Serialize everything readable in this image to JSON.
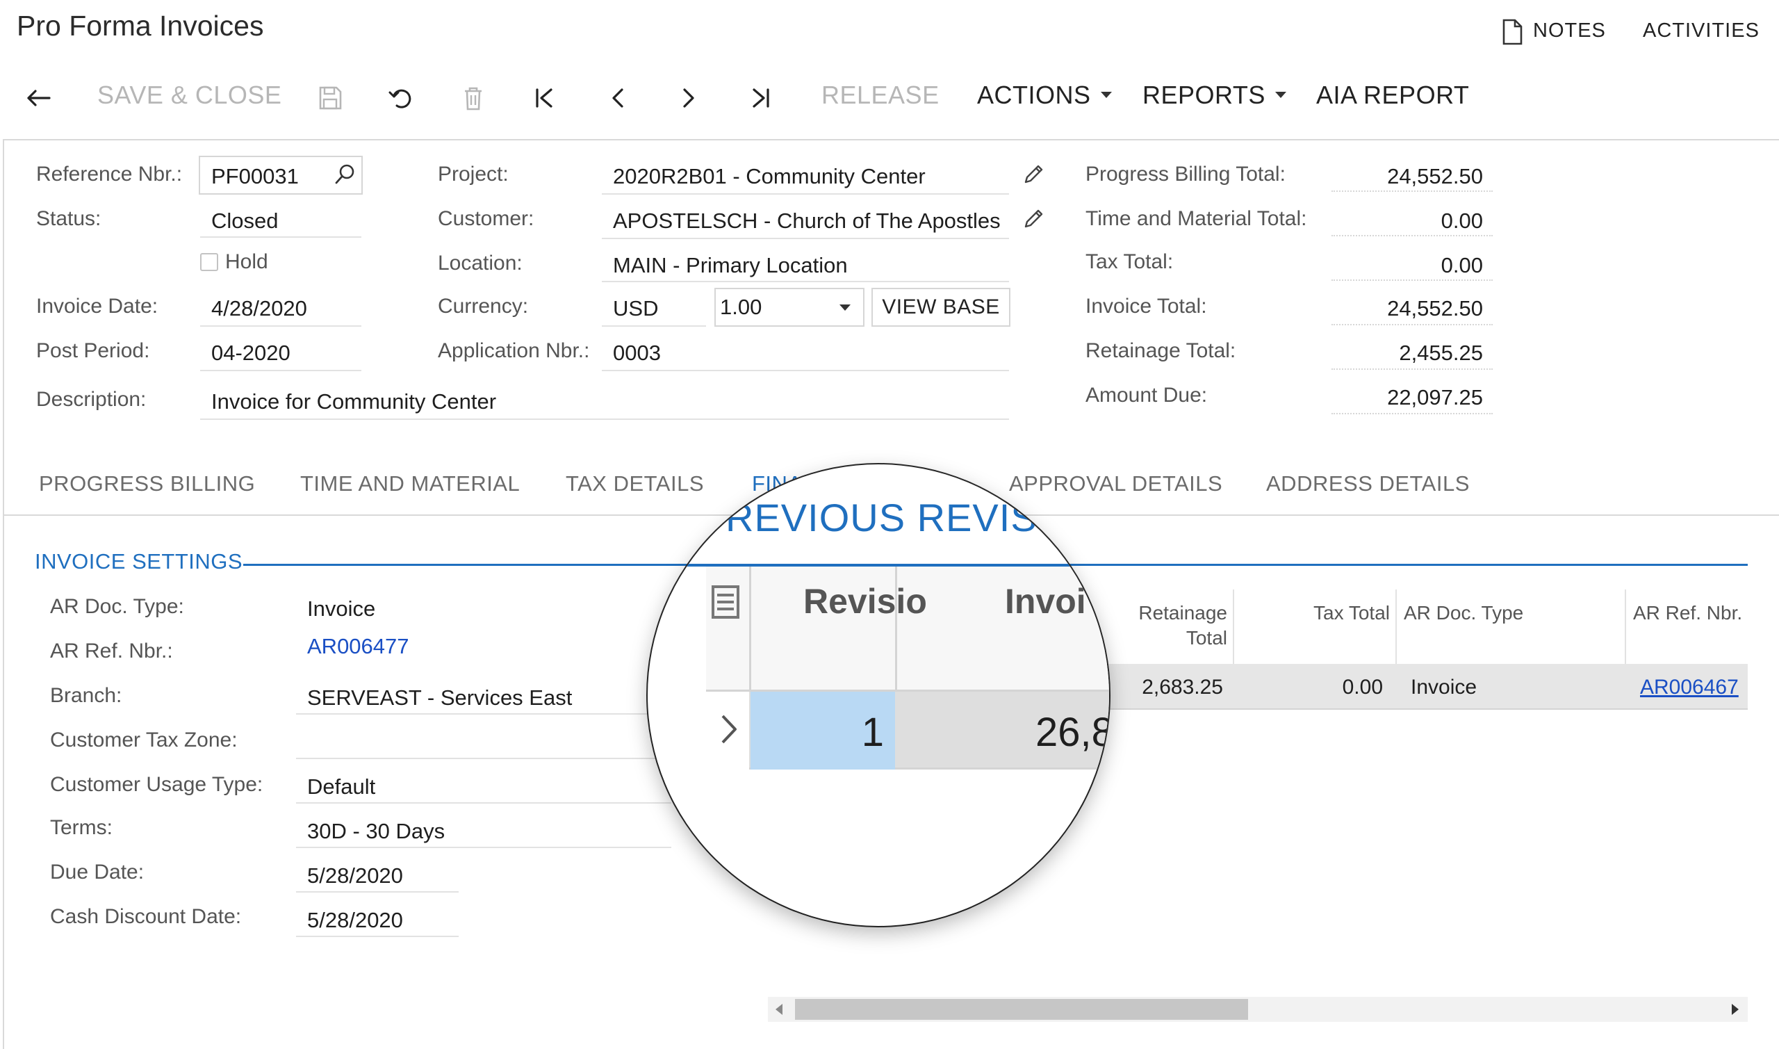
{
  "header": {
    "title": "Pro Forma Invoices",
    "notes_label": "NOTES",
    "activities_label": "ACTIVITIES"
  },
  "toolbar": {
    "save_close": "SAVE & CLOSE",
    "release": "RELEASE",
    "actions": "ACTIONS",
    "reports": "REPORTS",
    "aia_report": "AIA REPORT"
  },
  "form": {
    "reference_nbr_label": "Reference Nbr.:",
    "reference_nbr": "PF00031",
    "status_label": "Status:",
    "status": "Closed",
    "hold_label": "Hold",
    "invoice_date_label": "Invoice Date:",
    "invoice_date": "4/28/2020",
    "post_period_label": "Post Period:",
    "post_period": "04-2020",
    "description_label": "Description:",
    "description": "Invoice for Community Center",
    "project_label": "Project:",
    "project": "2020R2B01 - Community Center",
    "customer_label": "Customer:",
    "customer": "APOSTELSCH - Church of The Apostles",
    "location_label": "Location:",
    "location": "MAIN - Primary Location",
    "currency_label": "Currency:",
    "currency": "USD",
    "currency_rate": "1.00",
    "view_base": "VIEW BASE",
    "application_nbr_label": "Application Nbr.:",
    "application_nbr": "0003"
  },
  "totals": {
    "progress_billing_label": "Progress Billing Total:",
    "progress_billing": "24,552.50",
    "time_material_label": "Time and Material Total:",
    "time_material": "0.00",
    "tax_total_label": "Tax Total:",
    "tax_total": "0.00",
    "invoice_total_label": "Invoice Total:",
    "invoice_total": "24,552.50",
    "retainage_total_label": "Retainage Total:",
    "retainage_total": "2,455.25",
    "amount_due_label": "Amount Due:",
    "amount_due": "22,097.25"
  },
  "tabs": [
    "PROGRESS BILLING",
    "TIME AND MATERIAL",
    "TAX DETAILS",
    "FINA",
    "APPROVAL DETAILS",
    "ADDRESS DETAILS"
  ],
  "invoice_settings": {
    "title": "INVOICE SETTINGS",
    "ar_doc_type_label": "AR Doc. Type:",
    "ar_doc_type": "Invoice",
    "ar_ref_nbr_label": "AR Ref. Nbr.:",
    "ar_ref_nbr": "AR006477",
    "branch_label": "Branch:",
    "branch": "SERVEAST - Services East",
    "customer_tax_zone_label": "Customer Tax Zone:",
    "customer_tax_zone": "",
    "customer_usage_type_label": "Customer Usage Type:",
    "customer_usage_type": "Default",
    "terms_label": "Terms:",
    "terms": "30D - 30 Days",
    "due_date_label": "Due Date:",
    "due_date": "5/28/2020",
    "cash_discount_date_label": "Cash Discount Date:",
    "cash_discount_date": "5/28/2020"
  },
  "revisions_grid": {
    "columns": {
      "retainage_line1": "Retainage",
      "retainage_line2": "Total",
      "tax_total": "Tax Total",
      "ar_doc_type": "AR Doc. Type",
      "ar_ref_nbr": "AR Ref. Nbr."
    },
    "row": {
      "retainage_total": "2,683.25",
      "tax_total": "0.00",
      "ar_doc_type": "Invoice",
      "ar_ref_nbr": "AR006467"
    }
  },
  "magnifier": {
    "title": "REVIOUS REVISI",
    "col_revision": "Revisio",
    "col_invoice": "Invoi",
    "revision_value": "1",
    "invoice_value": "26,8"
  }
}
